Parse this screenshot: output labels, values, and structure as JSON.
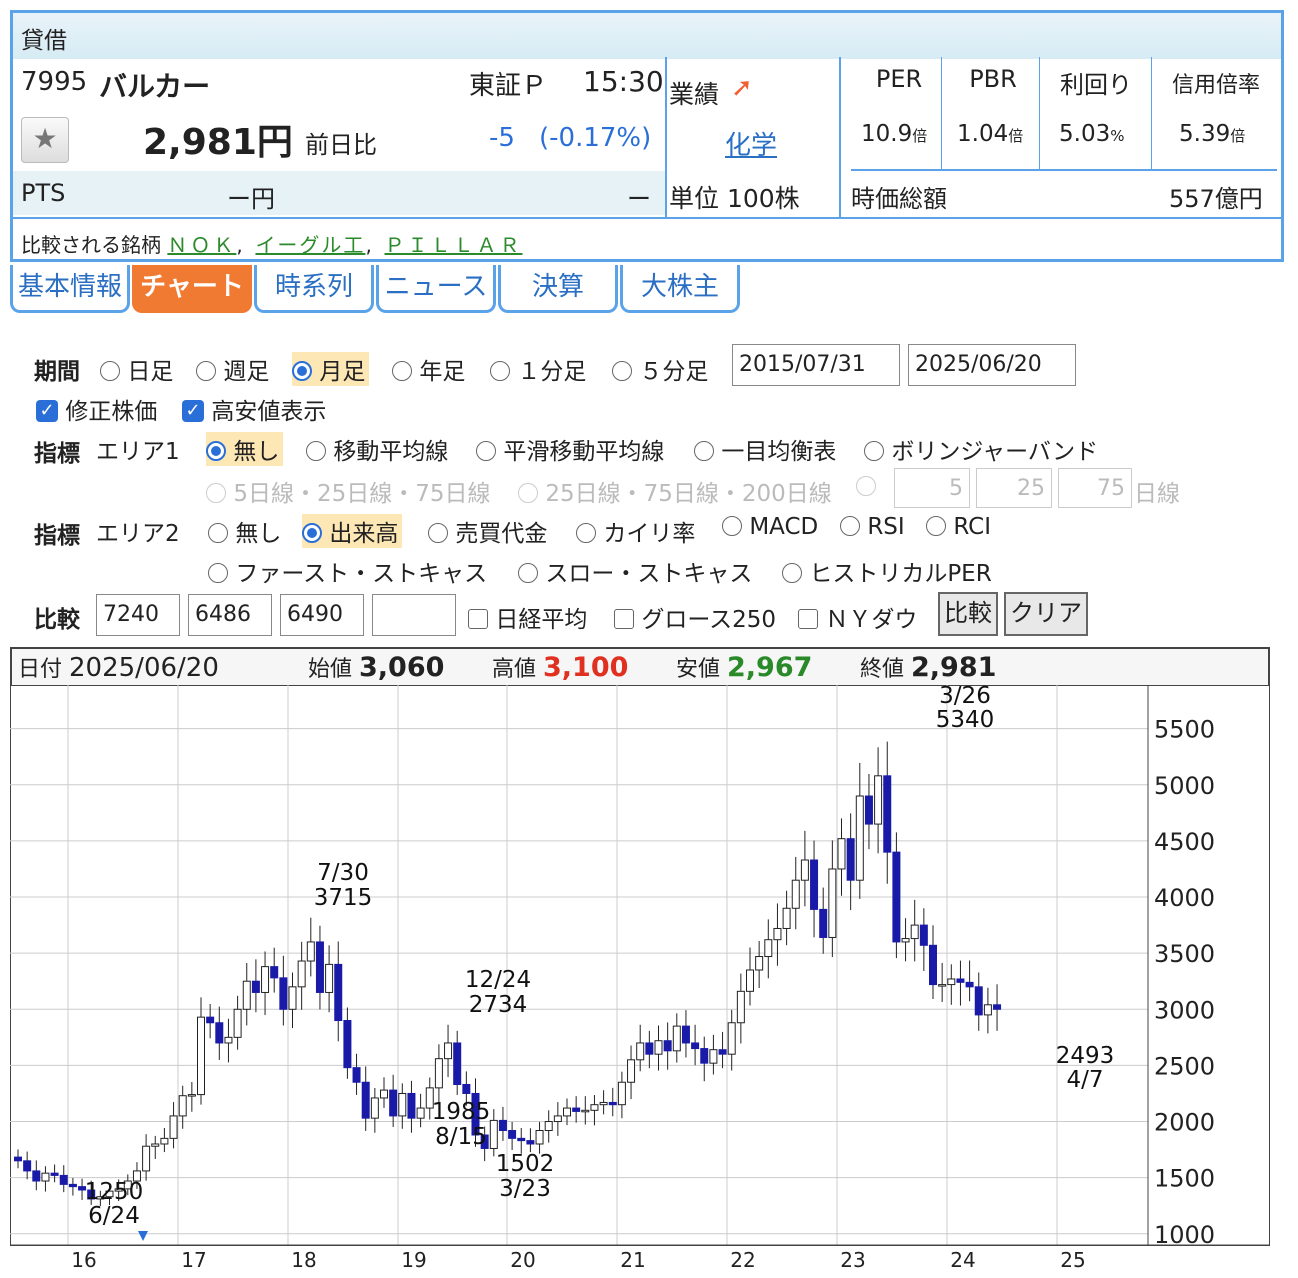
{
  "header": {
    "tag": "貸借",
    "code": "7995",
    "name": "バルカー",
    "market": "東証Ｐ",
    "time": "15:30",
    "price": "2,981円",
    "change_label": "前日比",
    "change": "-5",
    "change_pct": "(-0.17%)",
    "pts_label": "PTS",
    "pts_value": "ー円",
    "pts_change": "ー",
    "gyoseki_label": "業績",
    "sector": "化学",
    "unit": "単位 100株",
    "metrics": [
      {
        "label": "PER",
        "value": "10.9",
        "unit": "倍"
      },
      {
        "label": "PBR",
        "value": "1.04",
        "unit": "倍"
      },
      {
        "label": "利回り",
        "value": "5.03",
        "unit": "%"
      },
      {
        "label": "信用倍率",
        "value": "5.39",
        "unit": "倍"
      }
    ],
    "mcap_label": "時価総額",
    "mcap_value": "557億円",
    "compare_label": "比較される銘柄",
    "compare_links": [
      "ＮＯＫ",
      "イーグル工",
      "ＰＩＬＬＡＲ"
    ]
  },
  "tabs": [
    "基本情報",
    "チャート",
    "時系列",
    "ニュース",
    "決算",
    "大株主"
  ],
  "form": {
    "period_label": "期間",
    "period_options": [
      "日足",
      "週足",
      "月足",
      "年足",
      "１分足",
      "５分足"
    ],
    "date_from": "2015/07/31",
    "date_to": "2025/06/20",
    "adjusted_label": "修正株価",
    "highlow_label": "高安値表示",
    "indicator_label": "指標",
    "area1_label": "エリア1",
    "area1_options": [
      "無し",
      "移動平均線",
      "平滑移動平均線",
      "一目均衡表",
      "ボリンジャーバンド"
    ],
    "ma_options": [
      "5日線・25日線・75日線",
      "25日線・75日線・200日線"
    ],
    "ma_custom": [
      "5",
      "25",
      "75"
    ],
    "ma_unit": "日線",
    "area2_label": "エリア2",
    "area2_options": [
      "無し",
      "出来高",
      "売買代金",
      "カイリ率",
      "MACD",
      "RSI",
      "RCI"
    ],
    "area2_options_2": [
      "ファースト・ストキャス",
      "スロー・ストキャス",
      "ヒストリカルPER"
    ],
    "compare_label": "比較",
    "compare_codes": [
      "7240",
      "6486",
      "6490",
      ""
    ],
    "compare_checks": [
      "日経平均",
      "グロース250",
      "ＮＹダウ"
    ],
    "compare_button": "比較",
    "clear_button": "クリア"
  },
  "ohlc_bar": {
    "date_label": "日付",
    "date": "2025/06/20",
    "open_label": "始値",
    "open": "3,060",
    "high_label": "高値",
    "high": "3,100",
    "low_label": "安値",
    "low": "2,967",
    "close_label": "終値",
    "close": "2,981"
  },
  "colors": {
    "up": "#ffffff",
    "down": "#1a1aa8",
    "high": "#e03020",
    "low": "#2a8a2a",
    "tab_active": "#f07a31",
    "border": "#5ba3e8"
  },
  "chart_data": {
    "type": "candlestick",
    "x_ticks": [
      "16",
      "17",
      "18",
      "19",
      "20",
      "21",
      "22",
      "23",
      "24",
      "25"
    ],
    "y_ticks": [
      1000,
      1500,
      2000,
      2500,
      3000,
      3500,
      4000,
      4500,
      5000,
      5500
    ],
    "ylim": [
      900,
      5800
    ],
    "annotations": [
      {
        "date": "6/24",
        "value": "1250"
      },
      {
        "date": "7/30",
        "value": "3715"
      },
      {
        "date": "8/15",
        "value": "1985"
      },
      {
        "date": "12/24",
        "value": "2734"
      },
      {
        "date": "3/23",
        "value": "1502"
      },
      {
        "date": "3/26",
        "value": "5340"
      },
      {
        "date": "4/7",
        "value": "2493"
      }
    ],
    "closes": [
      1650,
      1560,
      1470,
      1540,
      1520,
      1440,
      1420,
      1390,
      1310,
      1330,
      1380,
      1400,
      1470,
      1560,
      1780,
      1800,
      1850,
      2050,
      2230,
      2240,
      2930,
      2880,
      2700,
      2750,
      3000,
      3250,
      3150,
      3380,
      3280,
      3000,
      3200,
      3430,
      3600,
      3150,
      3400,
      2900,
      2480,
      2350,
      2030,
      2210,
      2280,
      2050,
      2250,
      2030,
      2120,
      2300,
      2560,
      2700,
      2330,
      2250,
      1880,
      1760,
      2010,
      1920,
      1850,
      1830,
      1800,
      1920,
      2000,
      2050,
      2120,
      2090,
      2100,
      2150,
      2170,
      2150,
      2350,
      2550,
      2700,
      2600,
      2720,
      2630,
      2850,
      2700,
      2650,
      2520,
      2640,
      2600,
      2880,
      3160,
      3350,
      3470,
      3620,
      3720,
      3900,
      4150,
      4330,
      3890,
      3640,
      4250,
      4520,
      4150,
      4900,
      4650,
      5080,
      4400,
      3600,
      3630,
      3750,
      3570,
      3220,
      3220,
      3270,
      3240,
      3200,
      2950,
      3040,
      3000
    ]
  }
}
